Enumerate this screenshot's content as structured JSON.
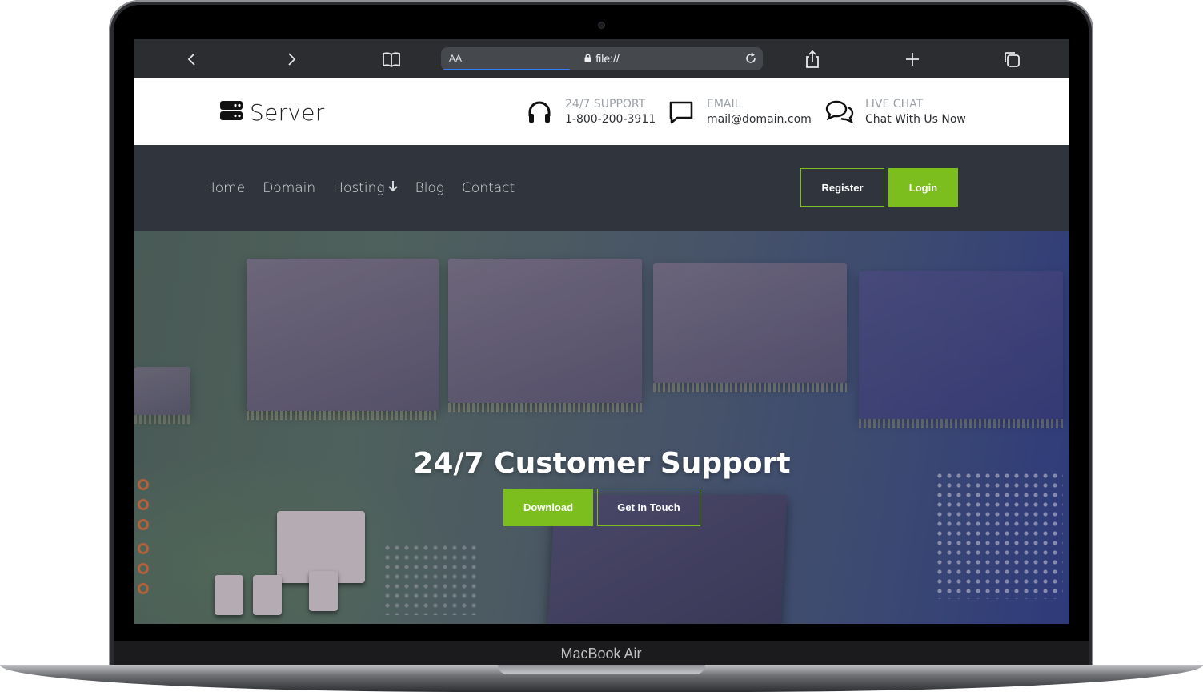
{
  "device": {
    "label": "MacBook Air"
  },
  "browser": {
    "aa_label": "AA",
    "url": "file://",
    "icons": [
      "back-icon",
      "forward-icon",
      "bookmarks-icon",
      "lock-icon",
      "reload-icon",
      "share-icon",
      "new-tab-icon",
      "tabs-icon"
    ]
  },
  "site": {
    "brand": "Server",
    "contacts": [
      {
        "icon": "headset-icon",
        "label": "24/7 SUPPORT",
        "value": "1-800-200-3911"
      },
      {
        "icon": "message-icon",
        "label": "EMAIL",
        "value": "mail@domain.com"
      },
      {
        "icon": "chat-icon",
        "label": "LIVE CHAT",
        "value": "Chat With Us Now"
      }
    ],
    "nav": {
      "links": [
        "Home",
        "Domain",
        "Hosting",
        "Blog",
        "Contact"
      ],
      "register": "Register",
      "login": "Login"
    },
    "hero": {
      "title": "24/7 Customer Support",
      "download": "Download",
      "get_in_touch": "Get In Touch"
    },
    "colors": {
      "accent": "#7dbe1f",
      "navbar": "#30353d",
      "toolbar": "#2b2d30"
    }
  }
}
